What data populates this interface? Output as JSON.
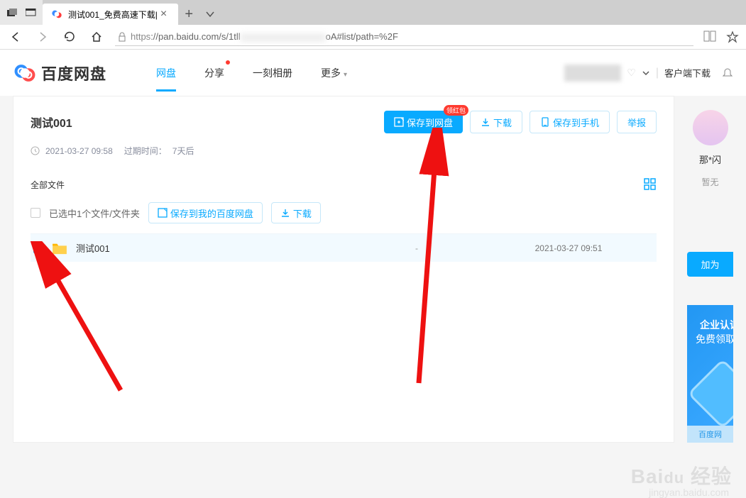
{
  "browser": {
    "tab_title": "测试001_免费高速下载|",
    "url_prefix": "https",
    "url_rest": "://pan.baidu.com/s/1tll",
    "url_tail": "oA#list/path=%2F"
  },
  "header": {
    "logo_text": "百度网盘",
    "tabs": {
      "wangpan": "网盘",
      "fenxiang": "分享",
      "yike": "一刻相册",
      "more": "更多"
    },
    "client_dl": "客户端下载"
  },
  "share": {
    "title": "测试001",
    "date": "2021-03-27 09:58",
    "expire_label": "过期时间：",
    "expire_val": "7天后",
    "save_btn": "保存到网盘",
    "badge": "领红包",
    "download_btn": "下载",
    "save_phone_btn": "保存到手机",
    "report_btn": "举报"
  },
  "files": {
    "crumb": "全部文件",
    "selected": "已选中1个文件/文件夹",
    "save_mine": "保存到我的百度网盘",
    "download": "下载",
    "rows": [
      {
        "name": "测试001",
        "size": "-",
        "date": "2021-03-27 09:51"
      }
    ]
  },
  "side": {
    "name": "那*闪",
    "sub": "暂无",
    "add_friend": "加为",
    "promo1": "企业认证",
    "promo2": "免费领取",
    "promo_footer": "百度网"
  },
  "watermark": {
    "main": "Baidu 经验",
    "sub": "jingyan.baidu.com"
  }
}
